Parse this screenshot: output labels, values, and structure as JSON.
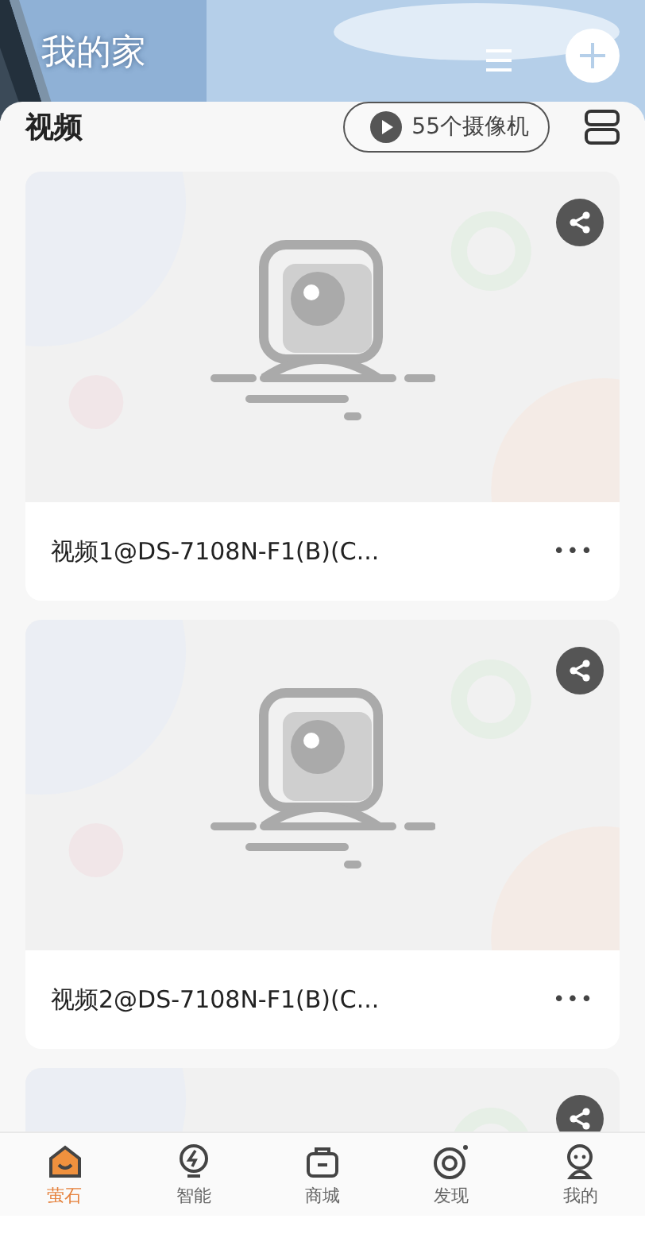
{
  "header": {
    "title": "我的家"
  },
  "section": {
    "title": "视频",
    "camera_count_button": "55个摄像机"
  },
  "cameras": [
    {
      "title": "视频1@DS-7108N-F1(B)(C...",
      "more": "•••"
    },
    {
      "title": "视频2@DS-7108N-F1(B)(C...",
      "more": "•••"
    }
  ],
  "tabs": [
    {
      "label": "萤石",
      "kind": "home",
      "selected": true
    },
    {
      "label": "智能",
      "kind": "smart",
      "selected": false
    },
    {
      "label": "商城",
      "kind": "shop",
      "selected": false
    },
    {
      "label": "发现",
      "kind": "discover",
      "selected": false
    },
    {
      "label": "我的",
      "kind": "me",
      "selected": false
    }
  ]
}
